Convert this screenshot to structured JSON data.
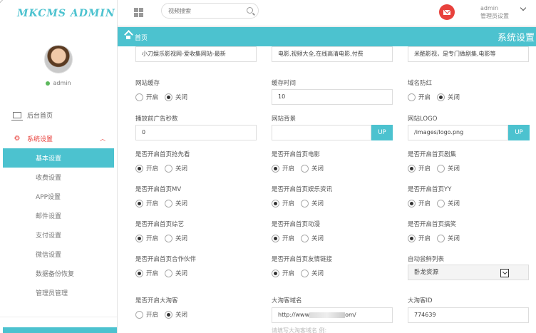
{
  "brand": "MKCMS ADMIN",
  "search": {
    "placeholder": "视频搜索"
  },
  "user": {
    "name": "admin",
    "role": "管理员设置",
    "status": "admin"
  },
  "breadcrumb": {
    "home": "首页",
    "section_title": "系统设置"
  },
  "sidebar": {
    "home": "后台首页",
    "system": "系统设置",
    "sub_items": [
      "基本设置",
      "收费设置",
      "APP设置",
      "邮件设置",
      "支付设置",
      "微信设置",
      "数据备份恢复",
      "管理员管理"
    ]
  },
  "radio_labels": {
    "on": "开启",
    "off": "关闭"
  },
  "form": {
    "site_title": "小刀娱乐影视网-爱收集网站-最新",
    "site_keywords": "电影,视频大全,在线高清电影,付费",
    "site_description": "米酷影视，是专门做剧集,电影等",
    "cache_label": "网站缓存",
    "cache_time_label": "缓存时间",
    "cache_time_value": "10",
    "anti_red_label": "域名防红",
    "ad_seconds_label": "播放前广告秒数",
    "ad_seconds_value": "0",
    "bg_label": "网站背景",
    "bg_value": "",
    "logo_label": "网站LOGO",
    "logo_value": "/images/logo.png",
    "up_label": "UP",
    "toggles": [
      {
        "label": "是否开启首页抢先看",
        "checked": "on"
      },
      {
        "label": "是否开启首页电影",
        "checked": "on"
      },
      {
        "label": "是否开启首页剧集",
        "checked": "on"
      },
      {
        "label": "是否开启首页MV",
        "checked": "on"
      },
      {
        "label": "是否开启首页娱乐资讯",
        "checked": "on"
      },
      {
        "label": "是否开启首页YY",
        "checked": "on"
      },
      {
        "label": "是否开启首页综艺",
        "checked": "on"
      },
      {
        "label": "是否开启首页动漫",
        "checked": "on"
      },
      {
        "label": "是否开启首页搞笑",
        "checked": "on"
      },
      {
        "label": "是否开启首页合作伙伴",
        "checked": "on"
      },
      {
        "label": "是否开启首页友情链接",
        "checked": "on"
      }
    ],
    "auto_list_label": "自动尝鲜列表",
    "auto_list_value": "卧龙资源",
    "taoke_label": "是否开启大淘客",
    "taoke_domain_label": "大淘客域名",
    "taoke_domain_prefix": "http://www",
    "taoke_domain_suffix": "om/",
    "taoke_id_label": "大淘客ID",
    "taoke_id_value": "774639",
    "taoke_hint": "请填写大淘客域名 例:"
  }
}
